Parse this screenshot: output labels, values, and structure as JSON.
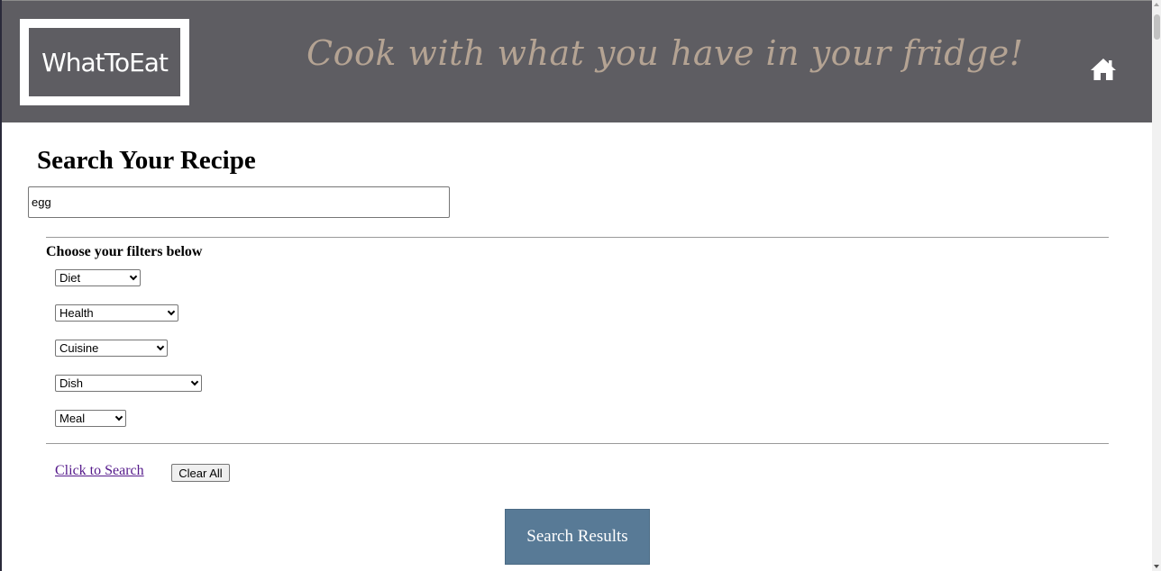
{
  "header": {
    "logo_text": "WhatToEat",
    "tagline": "Cook with what you have in your fridge!",
    "home_icon": "home-icon",
    "colors": {
      "background": "#5e5d62",
      "tagline": "#b4a393"
    }
  },
  "main": {
    "title": "Search Your Recipe",
    "search": {
      "value": "egg"
    },
    "filters": {
      "label": "Choose your filters below",
      "diet": "Diet",
      "health": "Health",
      "cuisine": "Cuisine",
      "dish": "Dish",
      "meal": "Meal"
    },
    "search_link": "Click to Search",
    "clear_label": "Clear All",
    "results_label": "Search Results",
    "colors": {
      "results_button": "#587a96",
      "link": "#551a8b"
    }
  }
}
